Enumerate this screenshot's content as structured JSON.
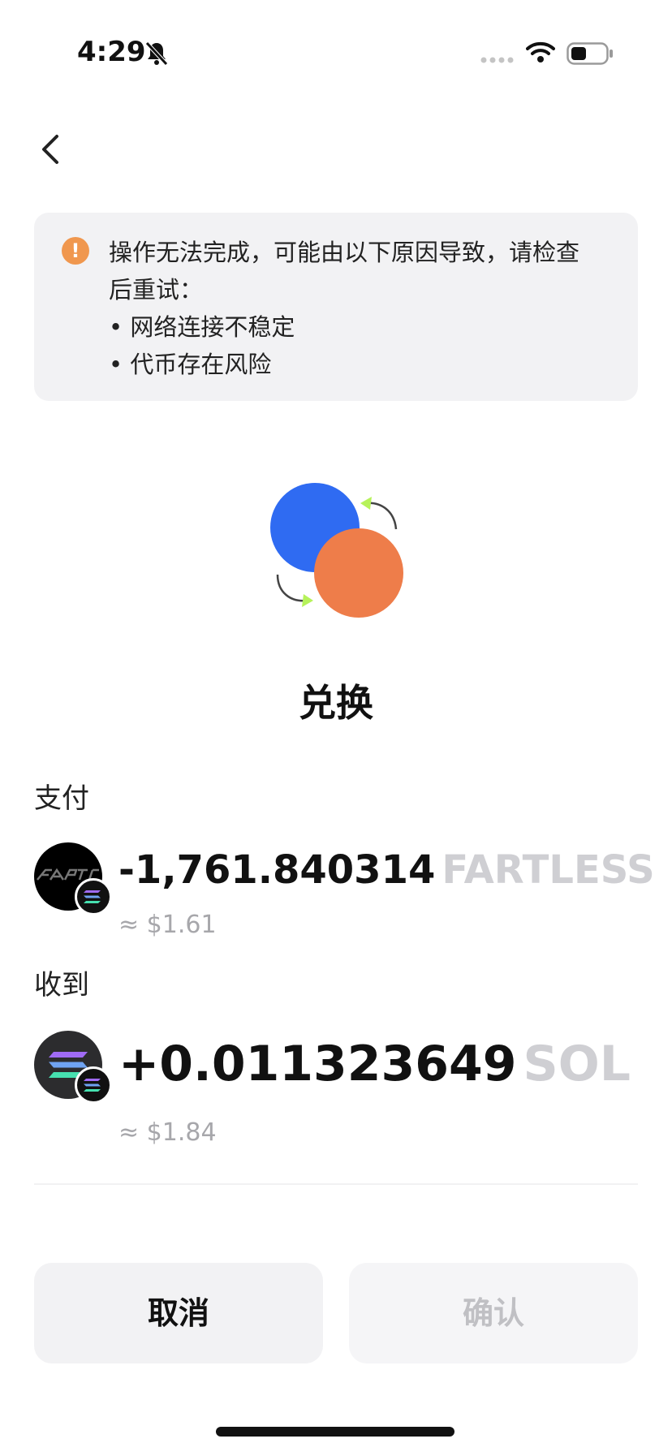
{
  "status_bar": {
    "time": "4:29"
  },
  "alert": {
    "icon": "!",
    "lines": [
      "操作无法完成，可能由以下原因导致，请检查",
      "后重试：",
      "• 网络连接不稳定",
      "• 代币存在风险"
    ]
  },
  "title": "兑换",
  "pay": {
    "label": "支付",
    "amount": "-1,761.840314",
    "symbol": "FARTLESS",
    "fiat": "≈ $1.61"
  },
  "receive": {
    "label": "收到",
    "amount": "+0.011323649",
    "symbol": "SOL",
    "fiat": "≈ $1.84"
  },
  "buttons": {
    "cancel": "取消",
    "confirm": "确认"
  },
  "icons": [
    "bell-slash-icon",
    "wifi-icon",
    "battery-icon",
    "chevron-left-icon",
    "warning-icon",
    "solana-icon"
  ],
  "colors": {
    "accent_blue": "#2f6bf2",
    "accent_orange": "#ee7d4a",
    "arrow_green": "#b6f25a",
    "warning": "#f0974e"
  }
}
